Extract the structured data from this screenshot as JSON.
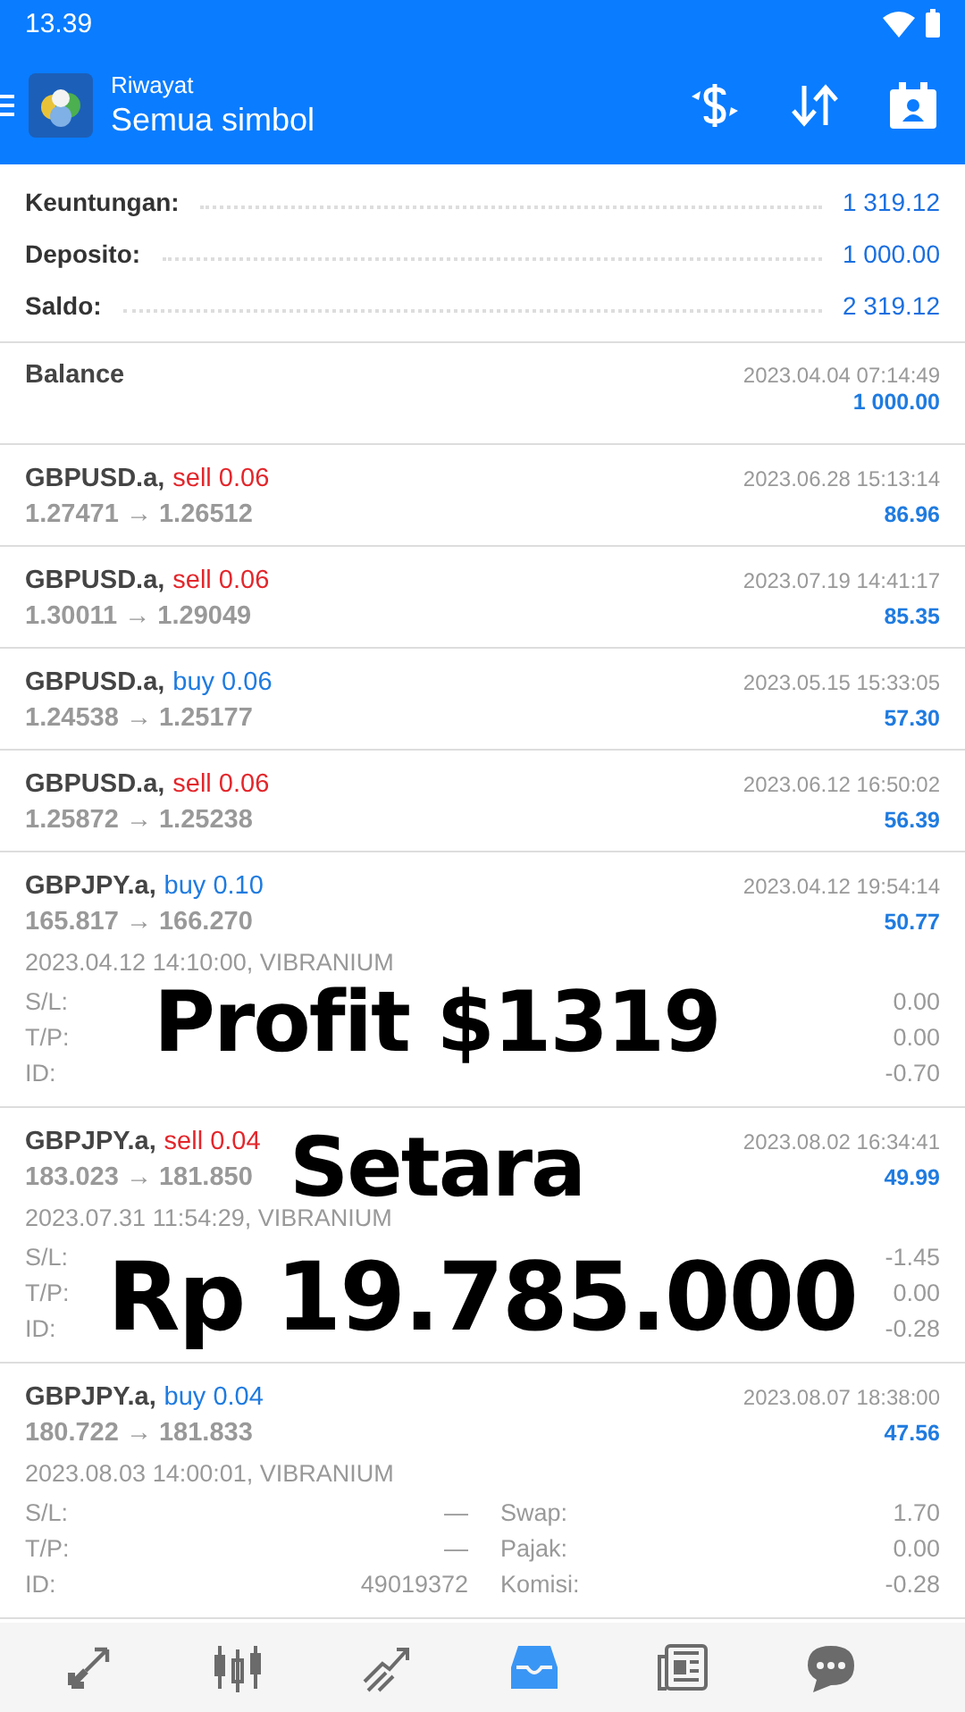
{
  "status_bar": {
    "time": "13.39"
  },
  "app_bar": {
    "subtitle": "Riwayat",
    "title": "Semua simbol"
  },
  "summary": [
    {
      "label": "Keuntungan:",
      "value": "1 319.12"
    },
    {
      "label": "Deposito:",
      "value": "1 000.00"
    },
    {
      "label": "Saldo:",
      "value": "2 319.12"
    }
  ],
  "balance": {
    "label": "Balance",
    "date": "2023.04.04 07:14:49",
    "amount": "1 000.00"
  },
  "trades": [
    {
      "symbol": "GBPUSD.a,",
      "side": "sell 0.06",
      "color": "#e3262b",
      "prices": "1.27471 → 1.26512",
      "date": "2023.06.28 15:13:14",
      "profit": "86.96"
    },
    {
      "symbol": "GBPUSD.a,",
      "side": "sell 0.06",
      "color": "#e3262b",
      "prices": "1.30011 → 1.29049",
      "date": "2023.07.19 14:41:17",
      "profit": "85.35"
    },
    {
      "symbol": "GBPUSD.a,",
      "side": "buy 0.06",
      "color": "#1f7be0",
      "prices": "1.24538 → 1.25177",
      "date": "2023.05.15 15:33:05",
      "profit": "57.30"
    },
    {
      "symbol": "GBPUSD.a,",
      "side": "sell 0.06",
      "color": "#e3262b",
      "prices": "1.25872 → 1.25238",
      "date": "2023.06.12 16:50:02",
      "profit": "56.39"
    },
    {
      "symbol": "GBPJPY.a,",
      "side": "buy 0.10",
      "color": "#1f7be0",
      "prices": "165.817 → 166.270",
      "date": "2023.04.12 19:54:14",
      "profit": "50.77",
      "opened": "2023.04.12 14:10:00, VIBRANIUM",
      "details": [
        {
          "label": "S/L:",
          "value2": "0.00"
        },
        {
          "label": "T/P:",
          "value2": "0.00"
        },
        {
          "label": "ID:",
          "value2": "-0.70"
        }
      ]
    },
    {
      "symbol": "GBPJPY.a,",
      "side": "sell 0.04",
      "color": "#e3262b",
      "prices": "183.023 → 181.850",
      "date": "2023.08.02 16:34:41",
      "profit": "49.99",
      "opened": "2023.07.31 11:54:29, VIBRANIUM",
      "details": [
        {
          "label": "S/L:",
          "value2": "-1.45"
        },
        {
          "label": "T/P:",
          "value2": "0.00"
        },
        {
          "label": "ID:",
          "value2": "-0.28"
        }
      ]
    },
    {
      "symbol": "GBPJPY.a,",
      "side": "buy 0.04",
      "color": "#1f7be0",
      "prices": "180.722 → 181.833",
      "date": "2023.08.07 18:38:00",
      "profit": "47.56",
      "opened": "2023.08.03 14:00:01, VIBRANIUM",
      "details": [
        {
          "label": "S/L:",
          "value": "—",
          "label2": "Swap:",
          "value2": "1.70"
        },
        {
          "label": "T/P:",
          "value": "—",
          "label2": "Pajak:",
          "value2": "0.00"
        },
        {
          "label": "ID:",
          "value": "49019372",
          "label2": "Komisi:",
          "value2": "-0.28"
        }
      ]
    }
  ],
  "captions": [
    {
      "text": "Profit $1319"
    },
    {
      "text": "Setara"
    },
    {
      "text": "Rp 19.785.000"
    }
  ],
  "nav": [
    {
      "kind": "trade",
      "selected": false
    },
    {
      "kind": "chart",
      "selected": false
    },
    {
      "kind": "analytics",
      "selected": false
    },
    {
      "kind": "history",
      "selected": true
    },
    {
      "kind": "news",
      "selected": false
    },
    {
      "kind": "chat",
      "selected": false
    }
  ]
}
